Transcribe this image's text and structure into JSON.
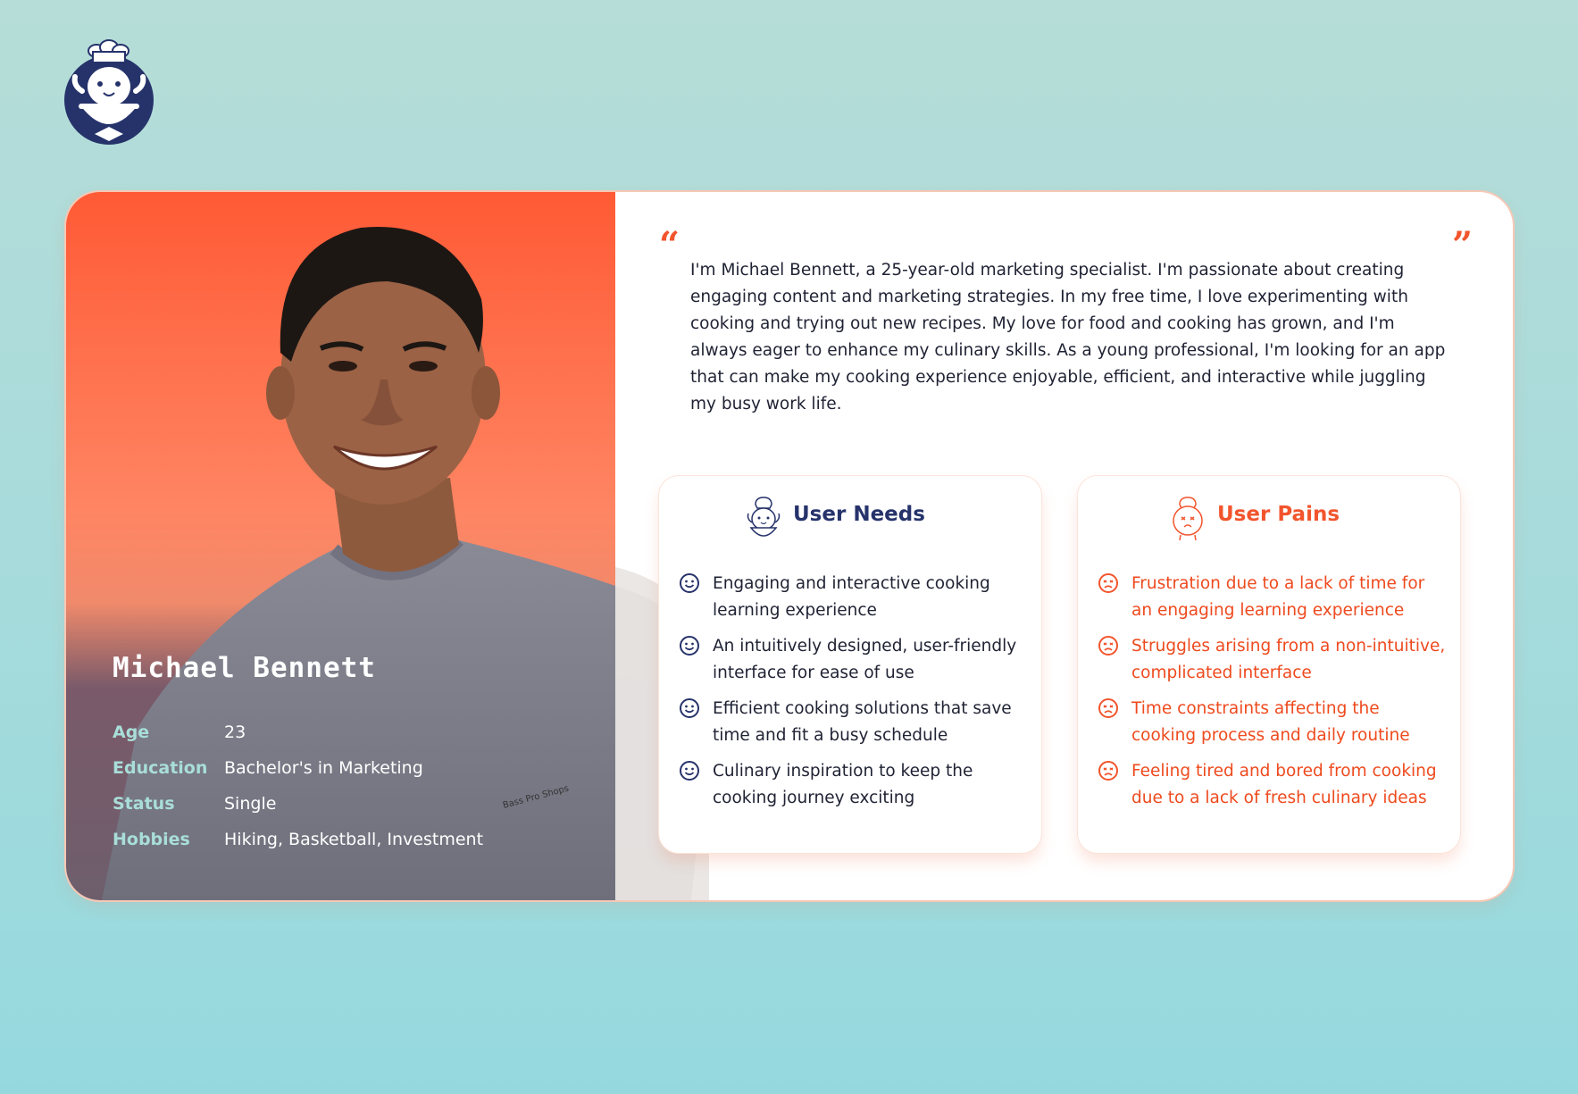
{
  "profile": {
    "name": "Michael Bennett",
    "attributes": [
      {
        "label": "Age",
        "value": "23"
      },
      {
        "label": "Education",
        "value": "Bachelor's in Marketing"
      },
      {
        "label": "Status",
        "value": "Single"
      },
      {
        "label": "Hobbies",
        "value": "Hiking, Basketball, Investment"
      }
    ],
    "shirt_text": "Bass Pro Shops"
  },
  "quote": {
    "open_mark": "“",
    "close_mark": "”",
    "text": "I'm Michael Bennett, a 25-year-old marketing specialist. I'm passionate about creating engaging content and marketing strategies. In my free time, I love experimenting with cooking and trying out new recipes. My love for food and cooking has grown, and I'm always eager to enhance my culinary skills. As a young professional, I'm looking for an app that can make my cooking experience enjoyable, efficient, and interactive while juggling my busy work life."
  },
  "needs": {
    "title": "User Needs",
    "icon": "chef-mascot-icon",
    "item_icon": "smile-icon",
    "items": [
      "Engaging and interactive cooking learning experience",
      "An intuitively designed, user-friendly interface for ease of use",
      "Efficient cooking solutions that save time and fit a busy schedule",
      "Culinary inspiration to keep the cooking journey exciting"
    ]
  },
  "pains": {
    "title": "User Pains",
    "icon": "upset-chef-mascot-icon",
    "item_icon": "frown-icon",
    "items": [
      "Frustration due to a lack of time for an engaging learning experience",
      "Struggles arising from a non-intuitive, complicated interface",
      "Time constraints affecting the cooking process and daily routine",
      "Feeling tired and bored from cooking due to a lack of fresh culinary ideas"
    ]
  },
  "colors": {
    "navy": "#26336b",
    "accent": "#f2552d",
    "teal_label": "#a9ded8"
  }
}
